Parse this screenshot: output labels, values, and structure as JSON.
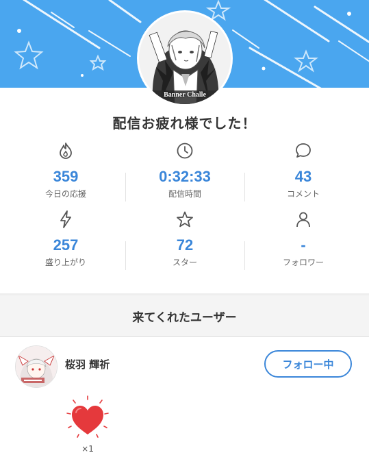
{
  "header": {
    "avatar_caption": "Banner Challe"
  },
  "title": "配信お疲れ様でした！",
  "stats": [
    {
      "icon": "flame-icon",
      "value": "359",
      "label": "今日の応援"
    },
    {
      "icon": "clock-icon",
      "value": "0:32:33",
      "label": "配信時間"
    },
    {
      "icon": "comment-icon",
      "value": "43",
      "label": "コメント"
    },
    {
      "icon": "lightning-icon",
      "value": "257",
      "label": "盛り上がり"
    },
    {
      "icon": "star-icon",
      "value": "72",
      "label": "スター"
    },
    {
      "icon": "person-icon",
      "value": "-",
      "label": "フォロワー"
    }
  ],
  "visitors": {
    "header": "来てくれたユーザー",
    "user_name": "桜羽 輝祈",
    "follow_label": "フォロー中",
    "gift_icon": "heart-icon",
    "gift_count": "×1"
  },
  "colors": {
    "banner": "#4aa6ef",
    "accent": "#3a86d9",
    "heart": "#e5393c"
  }
}
